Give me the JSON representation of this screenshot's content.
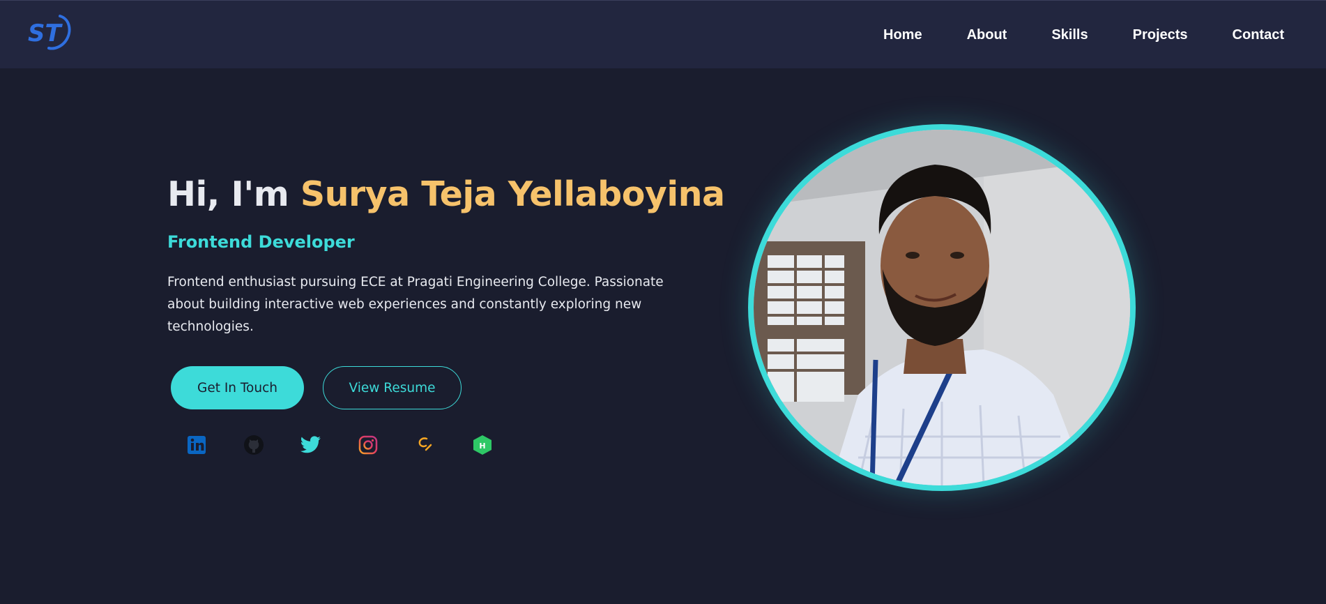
{
  "nav": {
    "logo_text": "ST",
    "links": [
      "Home",
      "About",
      "Skills",
      "Projects",
      "Contact"
    ]
  },
  "hero": {
    "greeting": "Hi, I'm ",
    "name": "Surya Teja Yellaboyina",
    "role": "Frontend Developer",
    "description": "Frontend enthusiast pursuing ECE at Pragati Engineering College. Passionate about building interactive web experiences and constantly exploring new technologies.",
    "primary_button": "Get In Touch",
    "secondary_button": "View Resume",
    "socials": [
      "linkedin-icon",
      "github-icon",
      "twitter-icon",
      "instagram-icon",
      "codechef-icon",
      "hackerrank-icon"
    ]
  },
  "colors": {
    "background": "#1a1d2e",
    "navbar": "#22263f",
    "accent": "#3ddbd9",
    "name": "#f6c26b",
    "text": "#e8eaf0"
  }
}
